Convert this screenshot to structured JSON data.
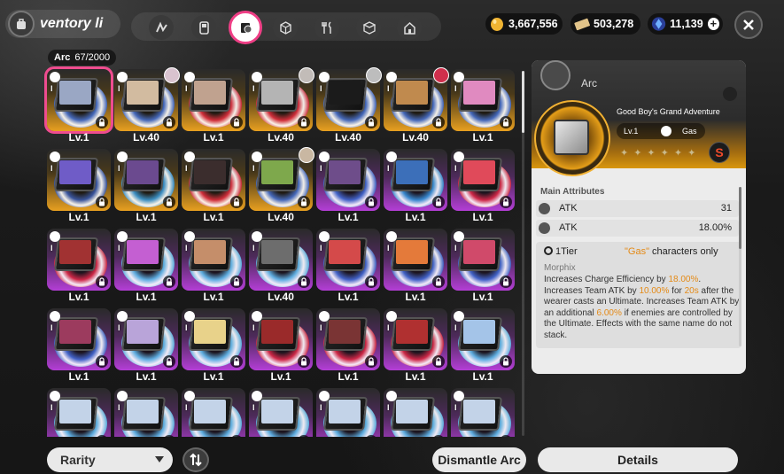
{
  "header": {
    "title": "ventory li",
    "tabs": [
      "network-icon",
      "device-icon",
      "arc-disc-icon",
      "cube-icon",
      "cutlery-icon",
      "package-icon",
      "home-icon"
    ],
    "active_tab": 2
  },
  "currencies": [
    {
      "icon": "gold-egg-icon",
      "value": "3,667,556",
      "color": "#f0b432"
    },
    {
      "icon": "ticket-icon",
      "value": "503,278",
      "color": "#e2c48a"
    },
    {
      "icon": "crystal-icon",
      "value": "11,139",
      "color": "#4c8cff"
    }
  ],
  "inventory": {
    "category": "Arc",
    "count": "67/2000",
    "cards": [
      {
        "level": "Lv.1",
        "bg": "gold",
        "disc": "#3a66c9",
        "art": "#9aa7c4",
        "avatar": false,
        "selected": true
      },
      {
        "level": "Lv.40",
        "bg": "gold",
        "disc": "#3a66c9",
        "art": "#d2bba0",
        "avatar": true,
        "avatar_color": "#d9c3cf"
      },
      {
        "level": "Lv.1",
        "bg": "gold",
        "disc": "#d3263d",
        "art": "#c0a28f",
        "avatar": false
      },
      {
        "level": "Lv.40",
        "bg": "gold",
        "disc": "#d3263d",
        "art": "#b4b4b4",
        "avatar": true,
        "avatar_color": "#c2bcb8"
      },
      {
        "level": "Lv.40",
        "bg": "gold",
        "disc": "#3a66c9",
        "art": "#1b1b1b",
        "avatar": true,
        "avatar_color": "#bdbdbd"
      },
      {
        "level": "Lv.40",
        "bg": "gold",
        "disc": "#3a66c9",
        "art": "#c08a4e",
        "avatar": true,
        "avatar_color": "#cf2f4c"
      },
      {
        "level": "Lv.1",
        "bg": "gold",
        "disc": "#3a66c9",
        "art": "#e08ac0",
        "avatar": false
      },
      {
        "level": "Lv.1",
        "bg": "gold",
        "disc": "#2c4fa8",
        "art": "#6f5cc7",
        "avatar": false
      },
      {
        "level": "Lv.1",
        "bg": "gold",
        "disc": "#2f8fd1",
        "art": "#6b4a8f",
        "avatar": false
      },
      {
        "level": "Lv.1",
        "bg": "gold",
        "disc": "#d3263d",
        "art": "#3b2d2d",
        "avatar": false
      },
      {
        "level": "Lv.40",
        "bg": "gold",
        "disc": "#3a66c9",
        "art": "#7ea84c",
        "avatar": true,
        "avatar_color": "#c9b7a2"
      },
      {
        "level": "Lv.1",
        "bg": "purple",
        "disc": "#3a66c9",
        "art": "#6e4d8a",
        "avatar": false
      },
      {
        "level": "Lv.1",
        "bg": "purple",
        "disc": "#2f8fd1",
        "art": "#3c6fb9",
        "avatar": false
      },
      {
        "level": "Lv.1",
        "bg": "purple",
        "disc": "#d3263d",
        "art": "#e04a5a",
        "avatar": false
      },
      {
        "level": "Lv.1",
        "bg": "purple",
        "disc": "#d3263d",
        "art": "#a13232",
        "avatar": false
      },
      {
        "level": "Lv.1",
        "bg": "purple",
        "disc": "#5ab9e6",
        "art": "#c45fd2",
        "avatar": false
      },
      {
        "level": "Lv.1",
        "bg": "purple",
        "disc": "#5ab9e6",
        "art": "#c58e6a",
        "avatar": false
      },
      {
        "level": "Lv.40",
        "bg": "purple",
        "disc": "#5ab9e6",
        "art": "#6d6d6d",
        "avatar": false
      },
      {
        "level": "Lv.1",
        "bg": "purple",
        "disc": "#3a66c9",
        "art": "#d44a4a",
        "avatar": false
      },
      {
        "level": "Lv.1",
        "bg": "purple",
        "disc": "#3a66c9",
        "art": "#e47a3a",
        "avatar": false
      },
      {
        "level": "Lv.1",
        "bg": "purple",
        "disc": "#3a66c9",
        "art": "#d04a6a",
        "avatar": false
      },
      {
        "level": "Lv.1",
        "bg": "purple",
        "disc": "#3a66c9",
        "art": "#9c3b5e",
        "avatar": false
      },
      {
        "level": "Lv.1",
        "bg": "purple",
        "disc": "#5ab9e6",
        "art": "#b9a4d9",
        "avatar": false
      },
      {
        "level": "Lv.1",
        "bg": "purple",
        "disc": "#5ab9e6",
        "art": "#e8d28a",
        "avatar": false
      },
      {
        "level": "Lv.1",
        "bg": "purple",
        "disc": "#d3263d",
        "art": "#9a2a2a",
        "avatar": false
      },
      {
        "level": "Lv.1",
        "bg": "purple",
        "disc": "#d3263d",
        "art": "#7a3434",
        "avatar": false
      },
      {
        "level": "Lv.1",
        "bg": "purple",
        "disc": "#d3263d",
        "art": "#b03030",
        "avatar": false
      },
      {
        "level": "Lv.1",
        "bg": "purple",
        "disc": "#5ab9e6",
        "art": "#a4c4e8",
        "avatar": false
      },
      {
        "level": "",
        "bg": "purple",
        "disc": "#5ab9e6",
        "art": "#c3d3e8",
        "avatar": false
      },
      {
        "level": "",
        "bg": "purple",
        "disc": "#5ab9e6",
        "art": "#c3d3e8",
        "avatar": false
      },
      {
        "level": "",
        "bg": "purple",
        "disc": "#5ab9e6",
        "art": "#c3d3e8",
        "avatar": false
      },
      {
        "level": "",
        "bg": "purple",
        "disc": "#5ab9e6",
        "art": "#c3d3e8",
        "avatar": false
      },
      {
        "level": "",
        "bg": "purple",
        "disc": "#5ab9e6",
        "art": "#c3d3e8",
        "avatar": false
      },
      {
        "level": "",
        "bg": "purple",
        "disc": "#5ab9e6",
        "art": "#c3d3e8",
        "avatar": false
      },
      {
        "level": "",
        "bg": "purple",
        "disc": "#5ab9e6",
        "art": "#c3d3e8",
        "avatar": false
      }
    ]
  },
  "bottom": {
    "rarity_label": "Rarity",
    "dismantle_label": "Dismantle Arc",
    "details_label": "Details"
  },
  "detail": {
    "category": "Arc",
    "name": "Good Boy's Grand Adventure",
    "level": "Lv.1",
    "element": "Gas",
    "stars": "✦✦✦✦✦✦",
    "rank": "S",
    "main_attributes_label": "Main Attributes",
    "attributes": [
      {
        "name": "ATK",
        "value": "31"
      },
      {
        "name": "ATK",
        "value": "18.00%"
      }
    ],
    "tier": "1Tier",
    "tier_condition_quote": "\"Gas\"",
    "tier_condition_rest": " characters only",
    "skill_name": "Morphix",
    "desc_1": "Increases Charge Efficiency by ",
    "val_1": "18.00%",
    "desc_2": ". Increases Team ATK by ",
    "val_2": "10.00%",
    "desc_3": " for ",
    "val_3": "20s",
    "desc_4": " after the wearer casts an Ultimate. Increases Team ATK by an additional ",
    "val_4": "6.00%",
    "desc_5": " if enemies are controlled by the Ultimate. Effects with the same name do not stack."
  }
}
